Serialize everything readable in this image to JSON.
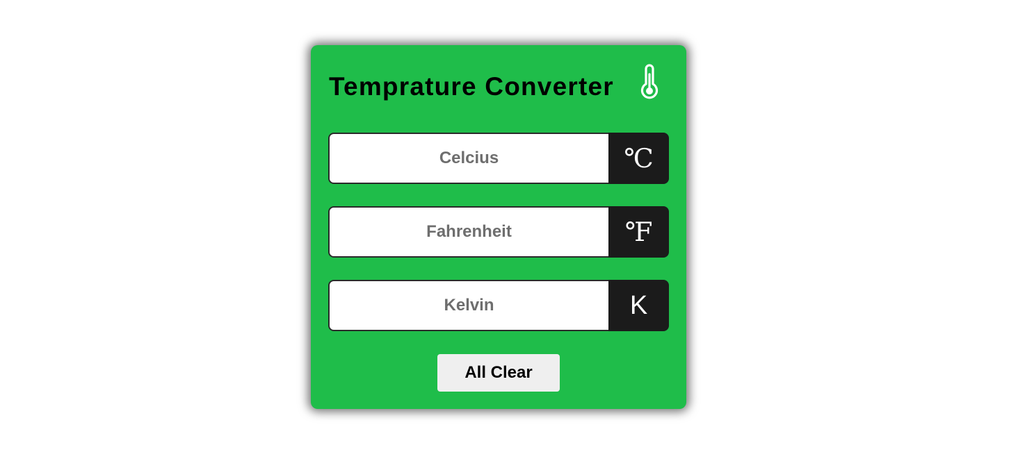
{
  "converter": {
    "title": "Temprature Converter",
    "title_icon": "thermometer-icon",
    "fields": [
      {
        "placeholder": "Celcius",
        "value": "",
        "unit": "℃"
      },
      {
        "placeholder": "Fahrenheit",
        "value": "",
        "unit": "℉"
      },
      {
        "placeholder": "Kelvin",
        "value": "",
        "unit": "K"
      }
    ],
    "clear_label": "All Clear"
  },
  "colors": {
    "card_background": "#1fbd4a",
    "unit_background": "#1b1b1b",
    "button_background": "#efefef",
    "icon_color": "#ffffff"
  }
}
